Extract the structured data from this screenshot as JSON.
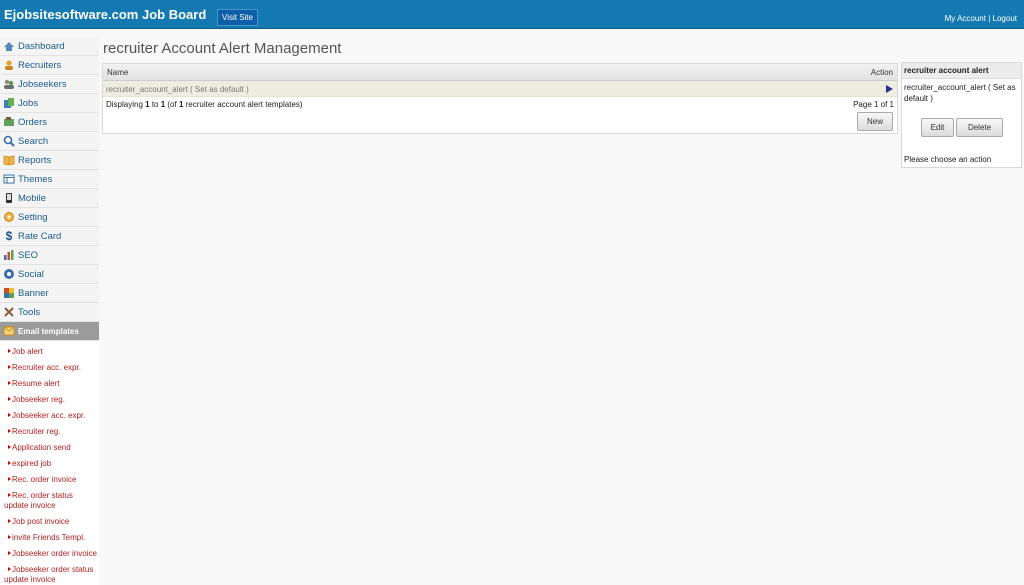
{
  "header": {
    "brand": "Ejobsitesoftware.com Job Board",
    "visit_site": "Visit Site",
    "my_account": "My Account",
    "separator": "|",
    "logout": "Logout"
  },
  "sidebar": {
    "items": [
      {
        "label": "Dashboard",
        "icon": "home-icon"
      },
      {
        "label": "Recruiters",
        "icon": "user-icon"
      },
      {
        "label": "Jobseekers",
        "icon": "users-icon"
      },
      {
        "label": "Jobs",
        "icon": "jobs-icon"
      },
      {
        "label": "Orders",
        "icon": "orders-icon"
      },
      {
        "label": "Search",
        "icon": "search-icon"
      },
      {
        "label": "Reports",
        "icon": "book-icon"
      },
      {
        "label": "Themes",
        "icon": "themes-icon"
      },
      {
        "label": "Mobile",
        "icon": "mobile-icon"
      },
      {
        "label": "Setting",
        "icon": "gear-icon"
      },
      {
        "label": "Rate Card",
        "icon": "dollar-icon"
      },
      {
        "label": "SEO",
        "icon": "chart-icon"
      },
      {
        "label": "Social",
        "icon": "globe-icon"
      },
      {
        "label": "Banner",
        "icon": "banner-icon"
      },
      {
        "label": "Tools",
        "icon": "tools-icon"
      },
      {
        "label": "Email templates",
        "icon": "envelope-icon"
      }
    ],
    "sub_items": [
      "Job alert",
      "Recruiter acc. expr.",
      "Resume alert",
      "Jobseeker reg.",
      "Jobseeker acc. expr.",
      "Recruiter reg.",
      "Application send",
      "expired job",
      "Rec. order invoice",
      "Rec. order status update invoice",
      "Job post invoice",
      "invite Friends Templ.",
      "Jobseeker order invoice",
      "Jobseeker order status update invoice"
    ]
  },
  "main": {
    "title": "recruiter Account Alert Management",
    "grid": {
      "columns": [
        "Name",
        "Action"
      ],
      "rows": [
        [
          "recruiter_account_alert ( Set as default )"
        ]
      ],
      "displaying_prefix": "Displaying ",
      "from": "1",
      "to_word": " to ",
      "to": "1",
      "of_prefix": " (of ",
      "total": "1",
      "of_suffix": " recruiter account alert templates)",
      "page_info": "Page 1 of 1",
      "new_button": "New"
    }
  },
  "panel": {
    "title": "recruiter account alert",
    "selected": "recruiter_account_alert ( Set as default )",
    "edit_button": "Edit",
    "delete_button": "Delete",
    "message": "Please choose an action"
  }
}
